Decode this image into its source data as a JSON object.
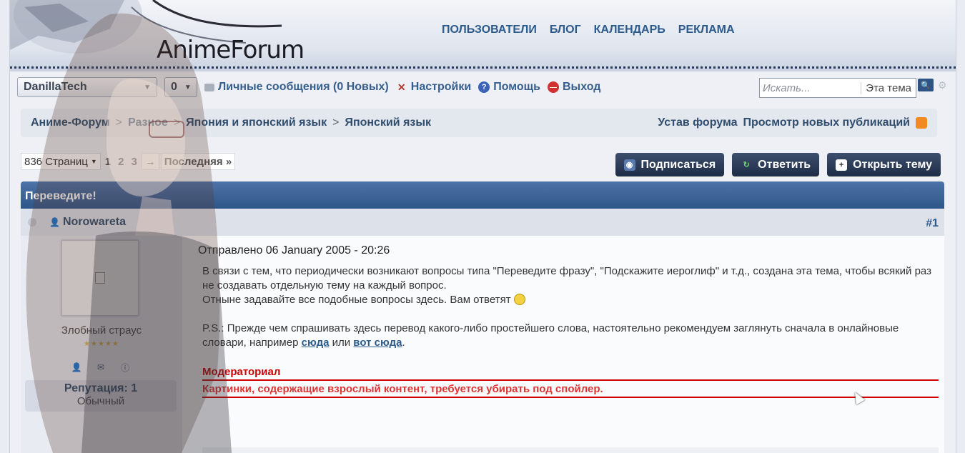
{
  "header": {
    "logo": "AnimeForum",
    "nav": [
      "ПОЛЬЗОВАТЕЛИ",
      "БЛОГ",
      "КАЛЕНДАРЬ",
      "РЕКЛАМА"
    ]
  },
  "userbar": {
    "username": "DanillaTech",
    "counter": "0",
    "messages": "Личные сообщения (0 Новых)",
    "settings": "Настройки",
    "help": "Помощь",
    "logout": "Выход"
  },
  "search": {
    "placeholder": "Искать...",
    "scope": "Эта тема"
  },
  "breadcrumb": {
    "items": [
      "Аниме-Форум",
      "Разное",
      "Япония и японский язык",
      "Японский язык"
    ],
    "sep": ">",
    "rules": "Устав форума",
    "new_posts": "Просмотр новых публикаций"
  },
  "pager": {
    "pages_label": "836 Страниц",
    "pages": [
      "1",
      "2",
      "3"
    ],
    "next": "→",
    "last": "Последняя »"
  },
  "actions": {
    "subscribe": "Подписаться",
    "reply": "Ответить",
    "new_topic": "Открыть тему"
  },
  "topic": {
    "title": "Переведите!"
  },
  "post": {
    "author": "Norowareta",
    "number": "#1",
    "posted": "Отправлено 06 January 2005 - 20:26",
    "line1": "В связи с тем, что периодически возникают вопросы типа \"Переведите фразу\", \"Подскажите иероглиф\" и т.д., создана эта тема, чтобы всякий раз не создавать отдельную тему на каждый вопрос.",
    "line2": "Отныне задавайте все подобные вопросы здесь. Вам ответят",
    "ps_prefix": "P.S.: Прежде чем спрашивать здесь перевод какого-либо простейшего слова, настоятельно рекомендуем заглянуть сначала в онлайновые словари, например",
    "link1": "сюда",
    "or": "или",
    "link2": "вот сюда",
    "dot": ".",
    "mod_title": "Модераториал",
    "mod_text": "Картинки, содержащие взрослый контент, требуется убирать под спойлер."
  },
  "profile": {
    "title": "Злобный страус",
    "stars": "★★★★★",
    "reputation": "Репутация: 1",
    "rep_level": "Обычный"
  },
  "colors": {
    "accent": "#2b5a8d",
    "topic_bar": "#3e6599",
    "mod_red": "#cc0000"
  }
}
